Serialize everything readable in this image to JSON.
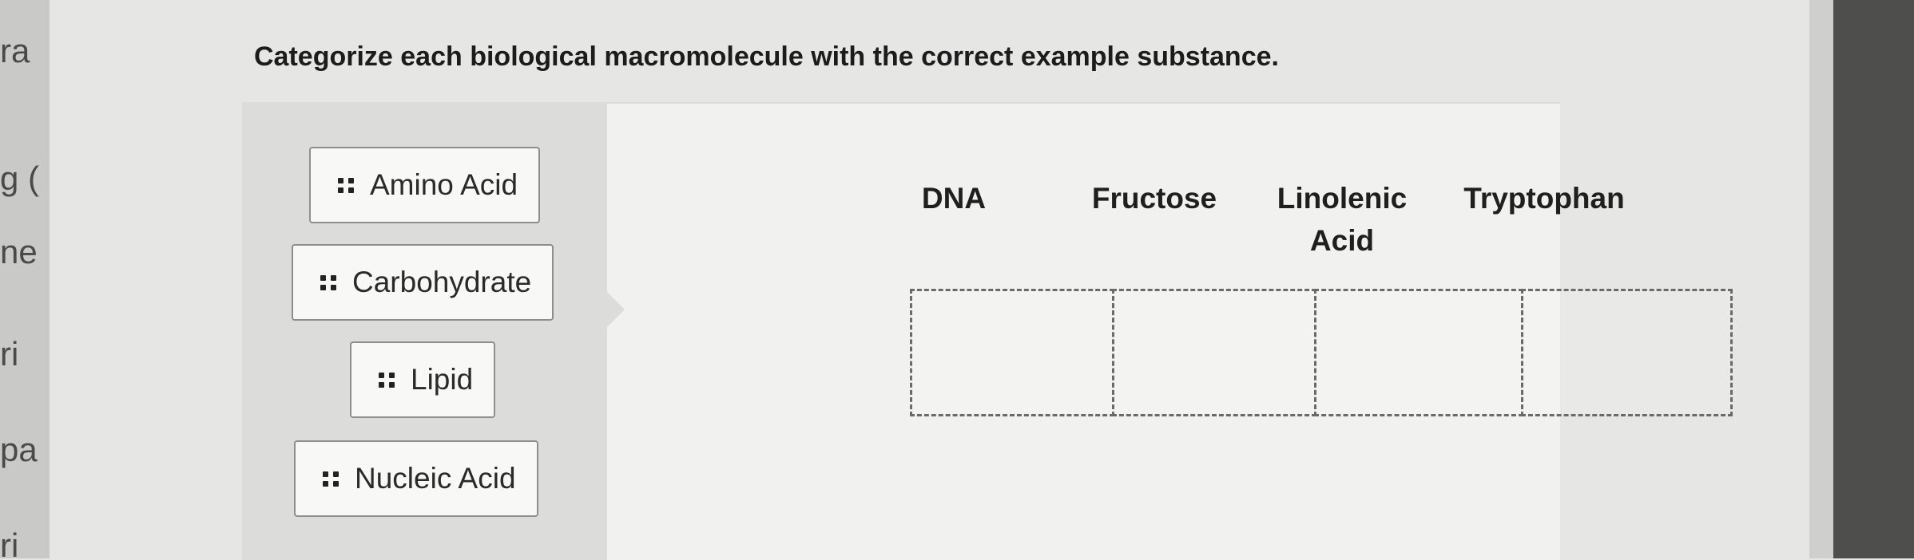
{
  "background_fragments": [
    "ra",
    "g (",
    "ne",
    "ri",
    "pa",
    "ri"
  ],
  "question": "Categorize each biological macromolecule with the correct example substance.",
  "bank": {
    "items": [
      {
        "label": "Amino Acid"
      },
      {
        "label": "Carbohydrate"
      },
      {
        "label": "Lipid"
      },
      {
        "label": "Nucleic Acid"
      }
    ]
  },
  "targets": [
    {
      "label": "DNA"
    },
    {
      "label": "Fructose"
    },
    {
      "label": "Linolenic Acid"
    },
    {
      "label": "Tryptophan"
    }
  ]
}
